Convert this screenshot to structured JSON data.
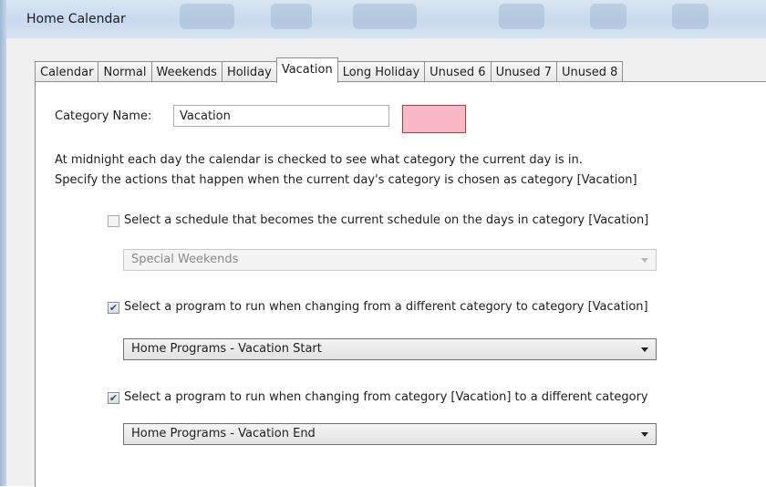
{
  "window": {
    "title": "Home Calendar"
  },
  "tabs": [
    {
      "label": "Calendar"
    },
    {
      "label": "Normal"
    },
    {
      "label": "Weekends"
    },
    {
      "label": "Holiday"
    },
    {
      "label": "Vacation",
      "active": true
    },
    {
      "label": "Long Holiday"
    },
    {
      "label": "Unused 6"
    },
    {
      "label": "Unused 7"
    },
    {
      "label": "Unused 8"
    }
  ],
  "category": {
    "name_label": "Category Name:",
    "name_value": "Vacation",
    "color": "#f9b8c6"
  },
  "description": {
    "line1": "At midnight each day the calendar is checked to see what category the current day is in.",
    "line2": "Specify the actions that happen when the current day's category is chosen as category [Vacation]"
  },
  "schedule": {
    "checked": false,
    "label": "Select a schedule that becomes the current schedule on the days in category [Vacation]",
    "selected": "Special Weekends",
    "enabled": false
  },
  "start_program": {
    "checked": true,
    "label": "Select a program to run when changing from a different category to category [Vacation]",
    "selected": "Home Programs - Vacation Start"
  },
  "end_program": {
    "checked": true,
    "label": "Select a program to run when changing from category [Vacation] to a different category",
    "selected": "Home Programs - Vacation End"
  },
  "colors": {
    "titlebar": "#c9daee",
    "panel": "#ffffff",
    "swatch_border": "#c0392b"
  }
}
